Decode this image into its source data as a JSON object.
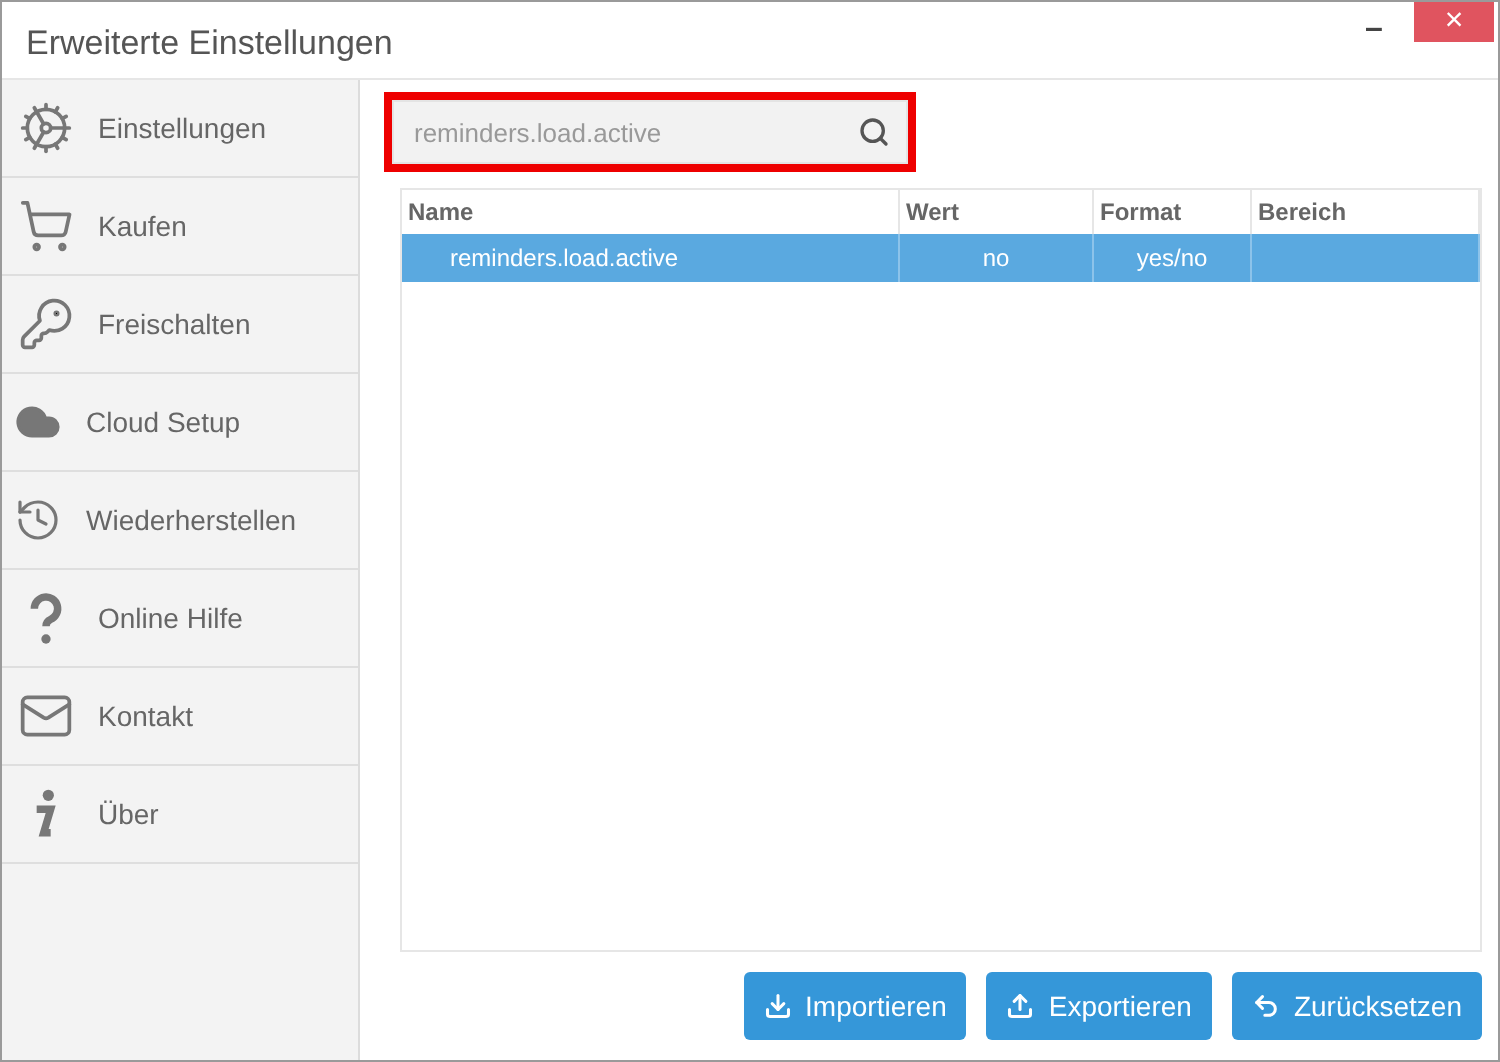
{
  "window": {
    "title": "Erweiterte Einstellungen",
    "controls": [
      "–",
      "×"
    ]
  },
  "sidebar": {
    "items": [
      {
        "label": "Einstellungen",
        "selected": false
      },
      {
        "label": "Kaufen",
        "selected": false
      },
      {
        "label": "Freischalten",
        "selected": false
      },
      {
        "label": "Cloud Setup",
        "selected": false
      },
      {
        "label": "Wiederherstellen",
        "selected": false
      },
      {
        "label": "Online Hilfe",
        "selected": false
      },
      {
        "label": "Kontakt",
        "selected": false
      },
      {
        "label": "Über",
        "selected": false
      }
    ]
  },
  "search": {
    "value": "reminders.load.active",
    "highlighted": true
  },
  "table": {
    "columns": [
      "Name",
      "Wert",
      "Format",
      "Bereich"
    ],
    "rows": [
      {
        "cells": [
          "reminders.load.active",
          "no",
          "yes/no",
          ""
        ],
        "selected": true
      }
    ]
  },
  "buttons": [
    {
      "label": "Importieren",
      "kind": "import"
    },
    {
      "label": "Exportieren",
      "kind": "export"
    },
    {
      "label": "Zurücksetzen",
      "kind": "reset"
    }
  ]
}
